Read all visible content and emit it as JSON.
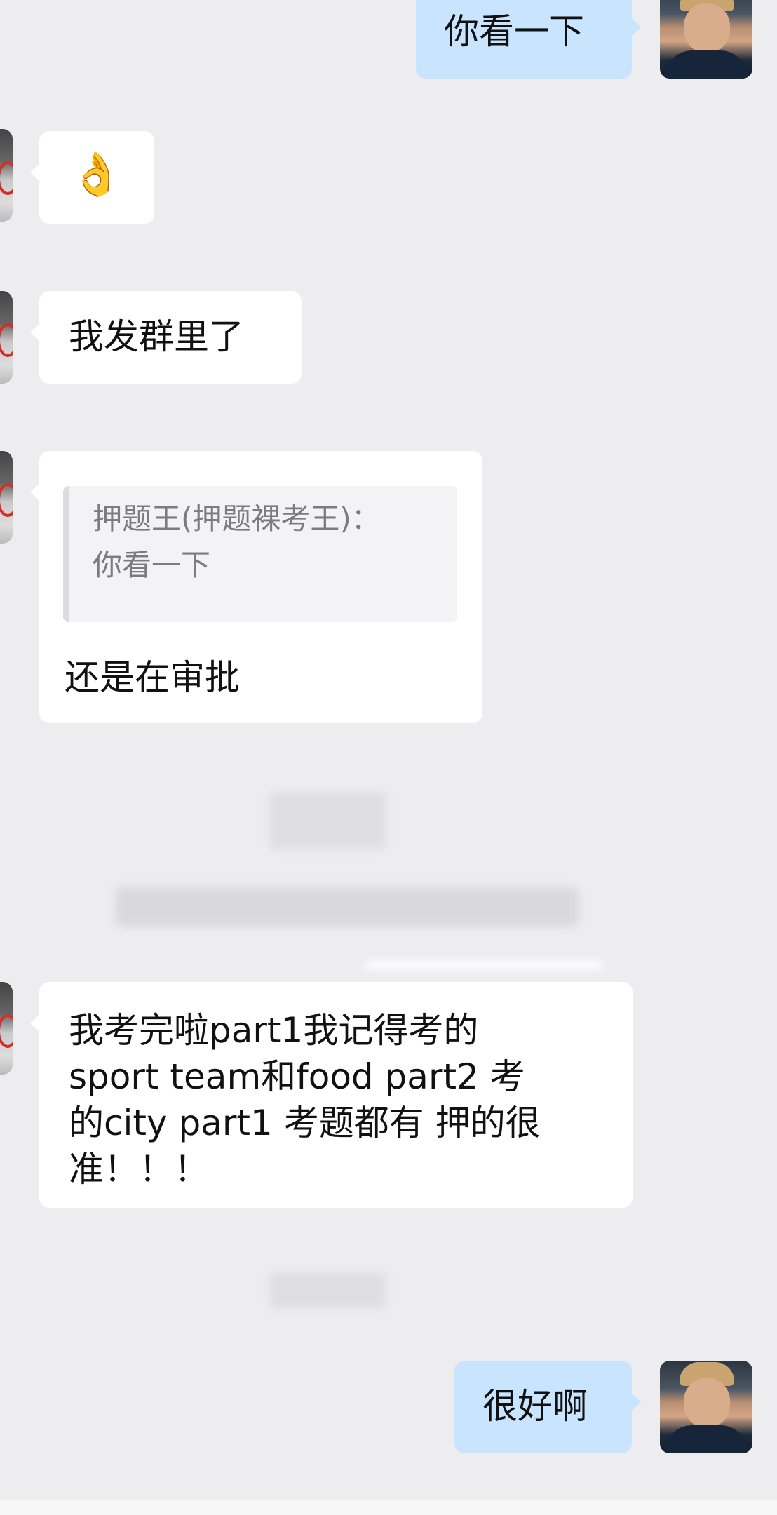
{
  "messages": [
    {
      "side": "right",
      "text": "你看一下"
    },
    {
      "side": "left",
      "emoji": "👌"
    },
    {
      "side": "left",
      "text": "我发群里了"
    },
    {
      "side": "left",
      "quote": {
        "author": "押题王(押题裸考王)：",
        "text": "你看一下"
      },
      "text": "还是在审批"
    },
    {
      "side": "left",
      "lines": [
        "我考完啦part1我记得考的",
        "sport team和food part2 考",
        "的city part1 考题都有 押的很",
        "准！！！"
      ]
    },
    {
      "side": "right",
      "text": "很好啊"
    }
  ],
  "colors": {
    "background": "#ededf0",
    "incoming_bubble": "#ffffff",
    "outgoing_bubble": "#c8e4ff",
    "quote_text": "#7c7c80"
  }
}
